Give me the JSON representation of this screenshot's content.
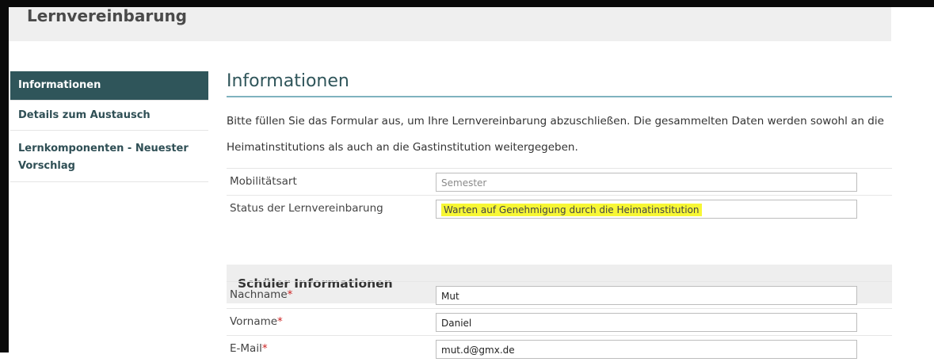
{
  "app": {
    "title": "Lernvereinbarung"
  },
  "sidebar": {
    "items": [
      {
        "label": "Informationen",
        "active": true
      },
      {
        "label": "Details zum Austausch",
        "active": false
      },
      {
        "label": "Lernkomponenten - Neuester Vorschlag",
        "active": false
      }
    ]
  },
  "main": {
    "title": "Informationen",
    "intro": "Bitte füllen Sie das Formular aus, um Ihre Lernvereinbarung abzuschließen. Die gesammelten Daten werden sowohl an die Heimatinstitutions als auch an die Gastinstitution weitergegeben.",
    "fields": [
      {
        "label": "Mobilitätsart",
        "value": "Semester"
      },
      {
        "label": "Status der Lernvereinbarung",
        "value": "Warten auf Genehmigung durch die Heimatinstitution"
      }
    ],
    "student_section": {
      "title": "Schüler Informationen",
      "required_marker": "*",
      "fields": [
        {
          "label": "Nachname",
          "value": "Mut"
        },
        {
          "label": "Vorname",
          "value": "Daniel"
        },
        {
          "label": "E-Mail",
          "value": "mut.d@gmx.de"
        }
      ]
    }
  },
  "colors": {
    "accent": "#2f555a",
    "highlight": "#f7f735",
    "rule": "#7fb2be",
    "required": "#cc2222"
  }
}
